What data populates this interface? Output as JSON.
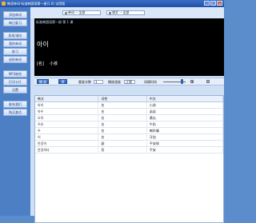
{
  "window": {
    "title": "韩语单词-标准韩国语第一册(1.0) 试用版"
  },
  "sidebar": {
    "items": [
      {
        "label": "添加单词"
      },
      {
        "label": "每日复习"
      },
      {
        "label": "多项/课文"
      },
      {
        "label": "我的单词"
      },
      {
        "label": "练习"
      },
      {
        "label": "进阶单词"
      },
      {
        "label": "MP3制作"
      },
      {
        "label": "打印卡片"
      },
      {
        "label": "设置"
      },
      {
        "label": "联系我们"
      },
      {
        "label": "购买激活"
      }
    ]
  },
  "topbar": {
    "book_select": "单词 -- 全部",
    "lesson_select": "课文 -- 全部"
  },
  "display": {
    "path": "标准韩国语第一册 第 1 课",
    "word": "아이",
    "tag": "[名]",
    "meaning": "小孩"
  },
  "controls": {
    "play_label": "播 放",
    "stop_label": "停",
    "interval_label": "重复次数",
    "interval_value": "1",
    "delay_label": "播放速度",
    "delay_value": "正常",
    "gap_label": "间隔时间"
  },
  "table": {
    "headers": [
      "韩文",
      "词性",
      "中文"
    ],
    "rows": [
      [
        "아이",
        "名",
        "小孩"
      ],
      [
        "아우",
        "名",
        "弟弟"
      ],
      [
        "오이",
        "名",
        "黄瓜"
      ],
      [
        "우유",
        "名",
        "牛奶"
      ],
      [
        "우",
        "名",
        "喇叭嘴"
      ],
      [
        "이",
        "名",
        "牙齿"
      ],
      [
        "안녕히",
        "副",
        "平安地"
      ],
      [
        "안녕하다",
        "形",
        "平安"
      ]
    ]
  }
}
